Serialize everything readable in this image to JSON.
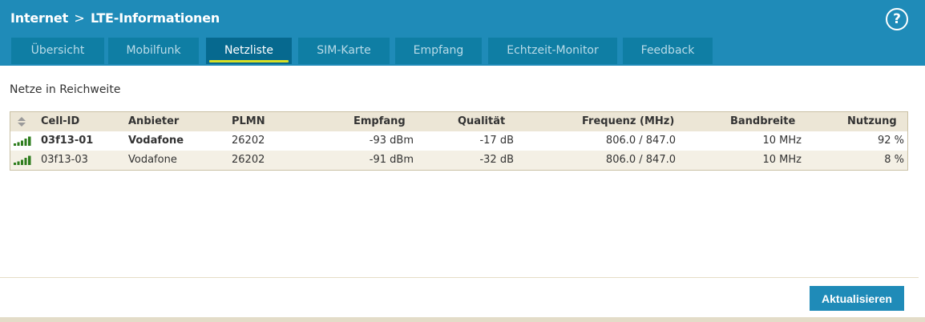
{
  "header": {
    "breadcrumb_root": "Internet",
    "breadcrumb_sep": ">",
    "breadcrumb_page": "LTE-Informationen",
    "help_label": "?"
  },
  "tabs": [
    {
      "label": "Übersicht",
      "active": false
    },
    {
      "label": "Mobilfunk",
      "active": false
    },
    {
      "label": "Netzliste",
      "active": true
    },
    {
      "label": "SIM-Karte",
      "active": false
    },
    {
      "label": "Empfang",
      "active": false
    },
    {
      "label": "Echtzeit-Monitor",
      "active": false
    },
    {
      "label": "Feedback",
      "active": false
    }
  ],
  "main": {
    "section_title": "Netze in Reichweite",
    "columns": [
      "Cell-ID",
      "Anbieter",
      "PLMN",
      "Empfang",
      "Qualität",
      "Frequenz (MHz)",
      "Bandbreite",
      "Nutzung"
    ],
    "rows": [
      {
        "cell_id": "03f13-01",
        "anbieter": "Vodafone",
        "plmn": "26202",
        "empfang": "-93 dBm",
        "qualitaet": "-17 dB",
        "frequenz": "806.0 / 847.0",
        "bandbreite": "10 MHz",
        "nutzung": "92 %",
        "signal_bars": 5,
        "bold": true
      },
      {
        "cell_id": "03f13-03",
        "anbieter": "Vodafone",
        "plmn": "26202",
        "empfang": "-91 dBm",
        "qualitaet": "-32 dB",
        "frequenz": "806.0 / 847.0",
        "bandbreite": "10 MHz",
        "nutzung": "8 %",
        "signal_bars": 5,
        "bold": false
      }
    ]
  },
  "footer": {
    "refresh_label": "Aktualisieren"
  },
  "colors": {
    "header": "#1f8bb8",
    "tab": "#0f7ea4",
    "tab_active": "#06698f",
    "tab_underline": "#d8e024",
    "table_head": "#ece6d6",
    "row_alt": "#f4f0e5",
    "signal": "#2e7d1e"
  }
}
